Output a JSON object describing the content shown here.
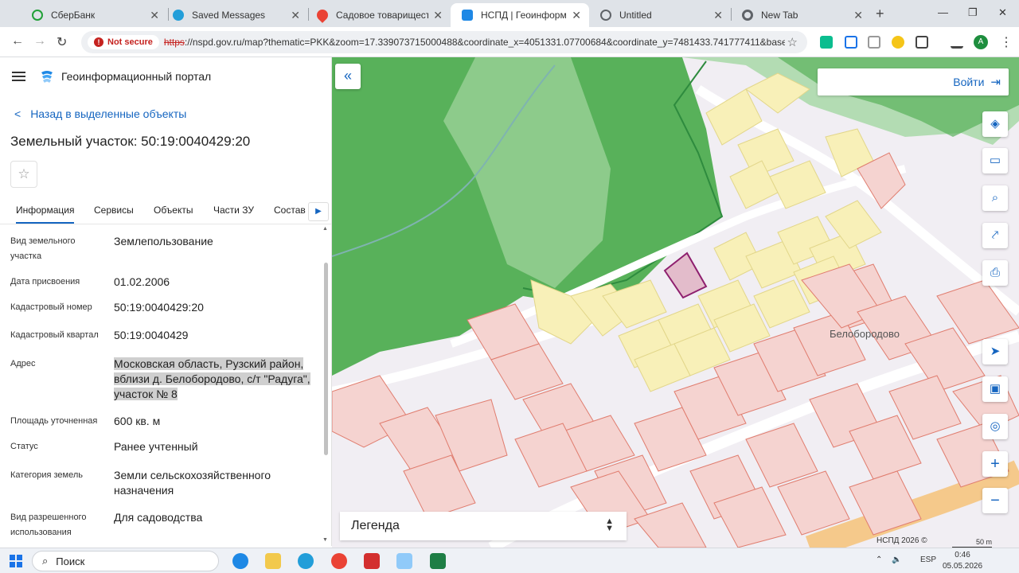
{
  "browser": {
    "tabs": [
      {
        "label": "СберБанк",
        "color": "#21a038"
      },
      {
        "label": "Saved Messages",
        "color": "#229ed9"
      },
      {
        "label": "Садовое товарищество Р",
        "color": "#ea4335"
      },
      {
        "label": "НСПД | Геоинформацион",
        "color": "#1e88e5"
      },
      {
        "label": "Untitled",
        "color": "#5f6368"
      },
      {
        "label": "New Tab",
        "color": "#5f6368"
      }
    ],
    "new_tab_symbol": "+",
    "not_secure_label": "Not secure",
    "url_protocol": "https",
    "url_rest": "://nspd.gov.ru/map?thematic=PKK&zoom=17.339073715000488&coordinate_x=4051331.07700684&coordinate_y=7481433.741777411&baseLay...",
    "profile_initial": "A"
  },
  "portal": {
    "title": "Геоинформационный портал",
    "back_label": "Назад в выделенные объекты",
    "object_title": "Земельный участок: 50:19:0040429:20",
    "tabs": [
      "Информация",
      "Сервисы",
      "Объекты",
      "Части ЗУ",
      "Состав"
    ],
    "attributes": [
      {
        "label": "Вид земельного участка",
        "value": "Землепользование"
      },
      {
        "label": "Дата присвоения",
        "value": "01.02.2006"
      },
      {
        "label": "Кадастровый номер",
        "value": "50:19:0040429:20"
      },
      {
        "label": "Кадастровый квартал",
        "value": "50:19:0040429"
      },
      {
        "label": "Адрес",
        "value": "Московская область, Рузский район, вблизи д. Белобородово, с/т \"Радуга\", участок № 8"
      },
      {
        "label": "Площадь уточненная",
        "value": "600 кв. м"
      },
      {
        "label": "Статус",
        "value": "Ранее учтенный"
      },
      {
        "label": "Категория земель",
        "value": "Земли сельскохозяйственного назначения"
      },
      {
        "label": "Вид разрешенного использования",
        "value": "Для садоводства"
      }
    ]
  },
  "map": {
    "login_label": "Войти",
    "legend_label": "Легенда",
    "place_label": "Белобородово",
    "attribution": "НСПД 2026 ©",
    "scale_label": "50 m",
    "icons": [
      "layers-icon",
      "ruler-icon",
      "search-area-icon",
      "share-icon",
      "print-icon",
      "locate-icon",
      "minimap-icon",
      "geo-search-icon",
      "zoom-in-icon",
      "zoom-out-icon"
    ],
    "colors": {
      "forest": "#58b15a",
      "forest_light": "#b3dcb3",
      "garden": "#f8f0b8",
      "parcel": "#f5d3d0",
      "parcel_stroke": "#e07d6f",
      "selected": "#8e1f6e",
      "accent": "#1565c0"
    }
  },
  "taskbar": {
    "search_label": "Поиск",
    "language": "ESP",
    "time": "0:46",
    "date": "05.05.2026"
  }
}
